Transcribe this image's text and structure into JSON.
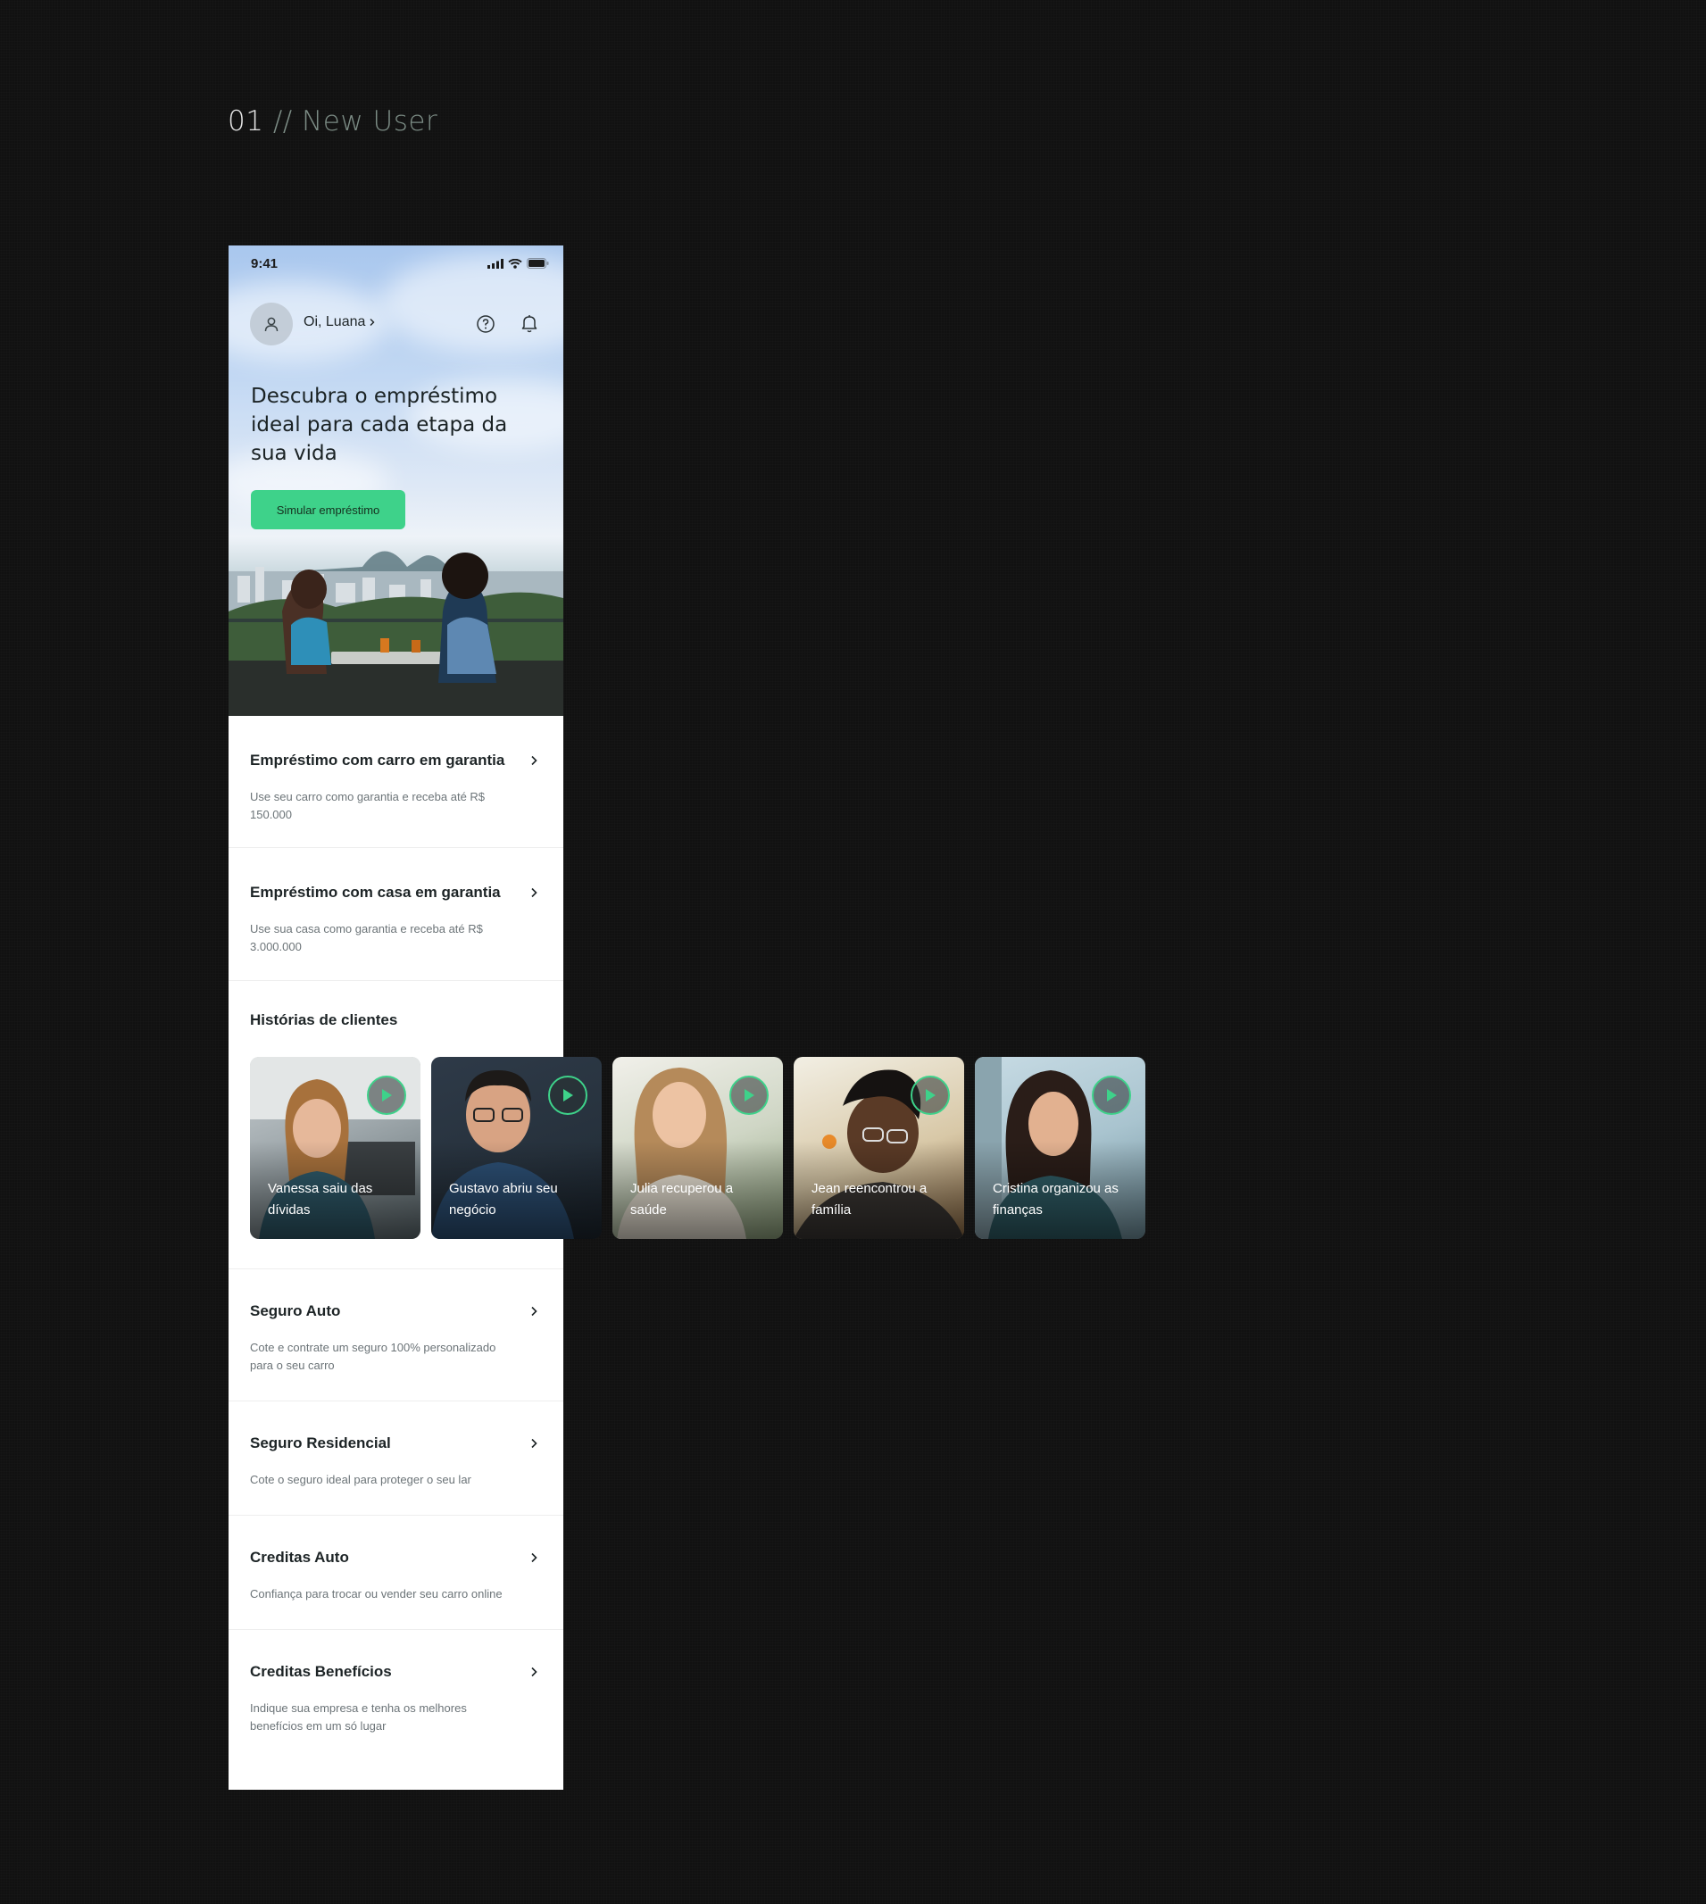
{
  "page_label": {
    "number": "01",
    "rest": "// New User"
  },
  "status_bar": {
    "time": "9:41"
  },
  "header": {
    "greeting": "Oi, Luana"
  },
  "hero": {
    "title": "Descubra o empréstimo ideal para cada etapa da sua vida",
    "cta_label": "Simular empréstimo"
  },
  "loans": [
    {
      "title": "Empréstimo com carro em garantia",
      "desc": "Use seu carro como garantia e receba até R$ 150.000"
    },
    {
      "title": "Empréstimo com casa em garantia",
      "desc": "Use sua casa como garantia e receba até R$ 3.000.000"
    }
  ],
  "stories": {
    "heading": "Histórias de clientes",
    "items": [
      {
        "caption": "Vanessa saiu das dívidas"
      },
      {
        "caption": "Gustavo abriu seu negócio"
      },
      {
        "caption": "Julia recuperou a saúde"
      },
      {
        "caption": "Jean reencontrou a família"
      },
      {
        "caption": "Cristina organizou as finanças"
      }
    ]
  },
  "products": [
    {
      "title": "Seguro Auto",
      "desc": "Cote e contrate um seguro 100% personalizado para o seu carro"
    },
    {
      "title": "Seguro Residencial",
      "desc": "Cote o seguro ideal para proteger o seu lar"
    },
    {
      "title": "Creditas Auto",
      "desc": "Confiança para trocar ou vender seu carro online"
    },
    {
      "title": "Creditas Benefícios",
      "desc": "Indique sua empresa e tenha os melhores benefícios em um só lugar"
    }
  ],
  "colors": {
    "accent": "#3ed28a",
    "background": "#111111",
    "text": "#1d2426"
  }
}
